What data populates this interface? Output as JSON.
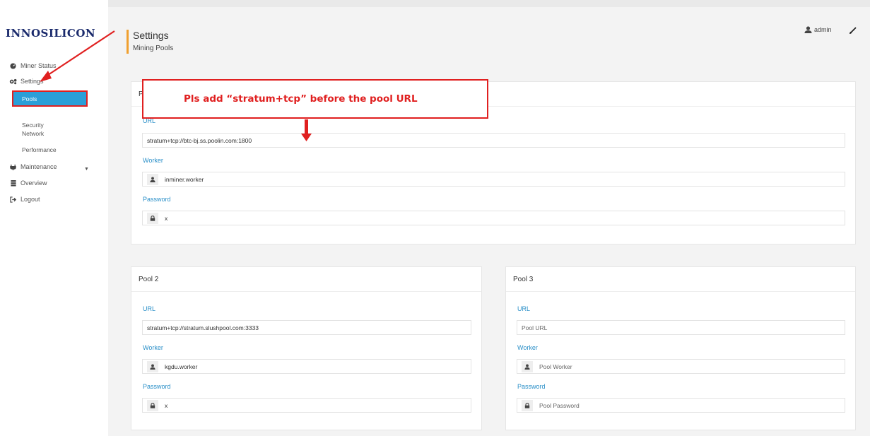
{
  "brand": {
    "logo_text": "INNOSILICON",
    "logo_color": "#1a2a6c"
  },
  "sidebar": {
    "items": [
      {
        "label": "Miner Status",
        "icon": "dashboard-icon"
      },
      {
        "label": "Settings",
        "icon": "gears-icon"
      },
      {
        "label": "Maintenance",
        "icon": "plug-icon"
      },
      {
        "label": "Overview",
        "icon": "server-icon"
      },
      {
        "label": "Logout",
        "icon": "logout-icon"
      }
    ],
    "settings_sub": [
      "Pools",
      "Security",
      "Network",
      "Performance"
    ],
    "active_sub": "Pools"
  },
  "header": {
    "title": "Settings",
    "subtitle": "Mining Pools",
    "user": "admin"
  },
  "annotation": {
    "text": "Pls add “stratum+tcp” before the pool URL",
    "color": "#e02020"
  },
  "pools": [
    {
      "title": "Pool 1",
      "url_label": "URL",
      "url_value": "stratum+tcp://btc-bj.ss.poolin.com:1800",
      "worker_label": "Worker",
      "worker_value": "inminer.worker",
      "password_label": "Password",
      "password_value": "x"
    },
    {
      "title": "Pool 2",
      "url_label": "URL",
      "url_value": "stratum+tcp://stratum.slushpool.com:3333",
      "worker_label": "Worker",
      "worker_value": "kgdu.worker",
      "password_label": "Password",
      "password_value": "x"
    },
    {
      "title": "Pool 3",
      "url_label": "URL",
      "url_placeholder": "Pool URL",
      "worker_label": "Worker",
      "worker_placeholder": "Pool Worker",
      "password_label": "Password",
      "password_placeholder": "Pool Password"
    }
  ],
  "colors": {
    "accent": "#2a9fd8",
    "label_blue": "#2a8fc8",
    "header_bar": "#f0a030",
    "highlight_red": "#e02020"
  }
}
